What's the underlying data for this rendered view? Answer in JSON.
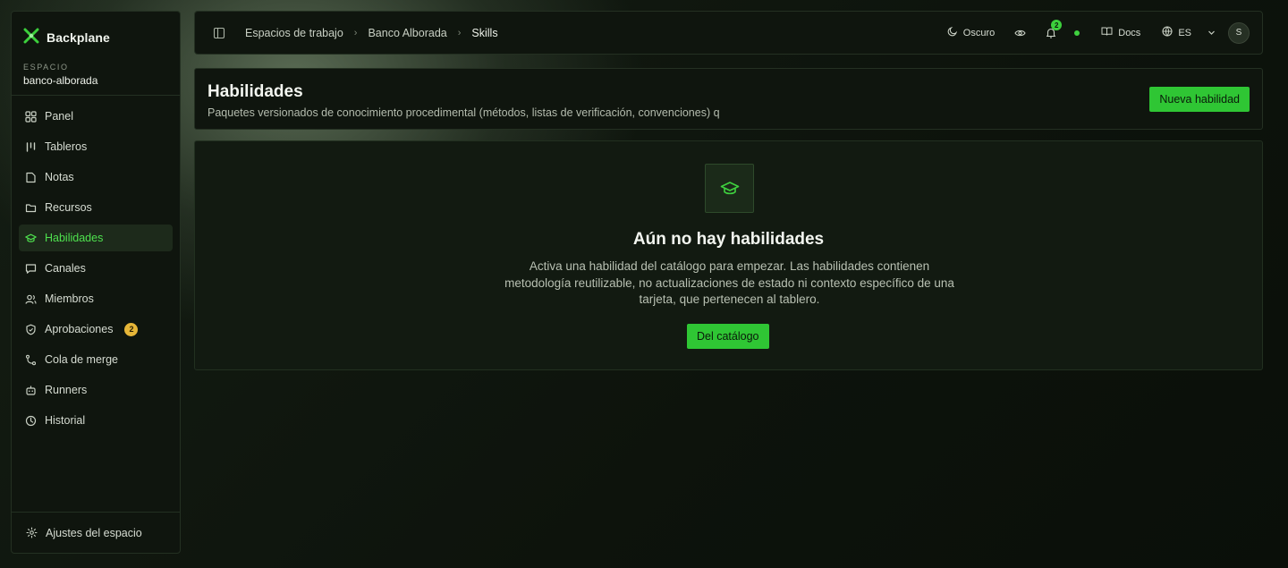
{
  "brand": {
    "name": "Backplane",
    "icon": "backplane-logo-icon",
    "accent": "#3ccf3c"
  },
  "workspace": {
    "label": "ESPACIO",
    "name": "banco-alborada"
  },
  "sidebar": {
    "items": [
      {
        "label": "Panel",
        "icon": "grid-icon"
      },
      {
        "label": "Tableros",
        "icon": "kanban-icon"
      },
      {
        "label": "Notas",
        "icon": "note-icon"
      },
      {
        "label": "Recursos",
        "icon": "folder-icon"
      },
      {
        "label": "Habilidades",
        "icon": "graduation-cap-icon",
        "active": true
      },
      {
        "label": "Canales",
        "icon": "message-icon"
      },
      {
        "label": "Miembros",
        "icon": "users-icon"
      },
      {
        "label": "Aprobaciones",
        "icon": "shield-icon",
        "badge": "2"
      },
      {
        "label": "Cola de merge",
        "icon": "merge-icon"
      },
      {
        "label": "Runners",
        "icon": "robot-icon"
      },
      {
        "label": "Historial",
        "icon": "history-icon"
      }
    ],
    "settings_label": "Ajustes del espacio"
  },
  "topbar": {
    "breadcrumbs": [
      "Espacios de trabajo",
      "Banco Alborada",
      "Skills"
    ],
    "theme_label": "Oscuro",
    "notifications_count": "2",
    "docs_label": "Docs",
    "language": "ES",
    "avatar_initial": "S"
  },
  "header": {
    "title": "Habilidades",
    "subtitle": "Paquetes versionados de conocimiento procedimental (métodos, listas de verificación, convenciones) q",
    "new_button": "Nueva habilidad"
  },
  "empty_state": {
    "title": "Aún no hay habilidades",
    "description": "Activa una habilidad del catálogo para empezar. Las habilidades contienen metodología reutilizable, no actualizaciones de estado ni contexto específico de una tarjeta, que pertenecen al tablero.",
    "button": "Del catálogo"
  },
  "colors": {
    "accent": "#2fc634",
    "badge_warning": "#e6b638",
    "panel_bg": "#0f150e"
  }
}
